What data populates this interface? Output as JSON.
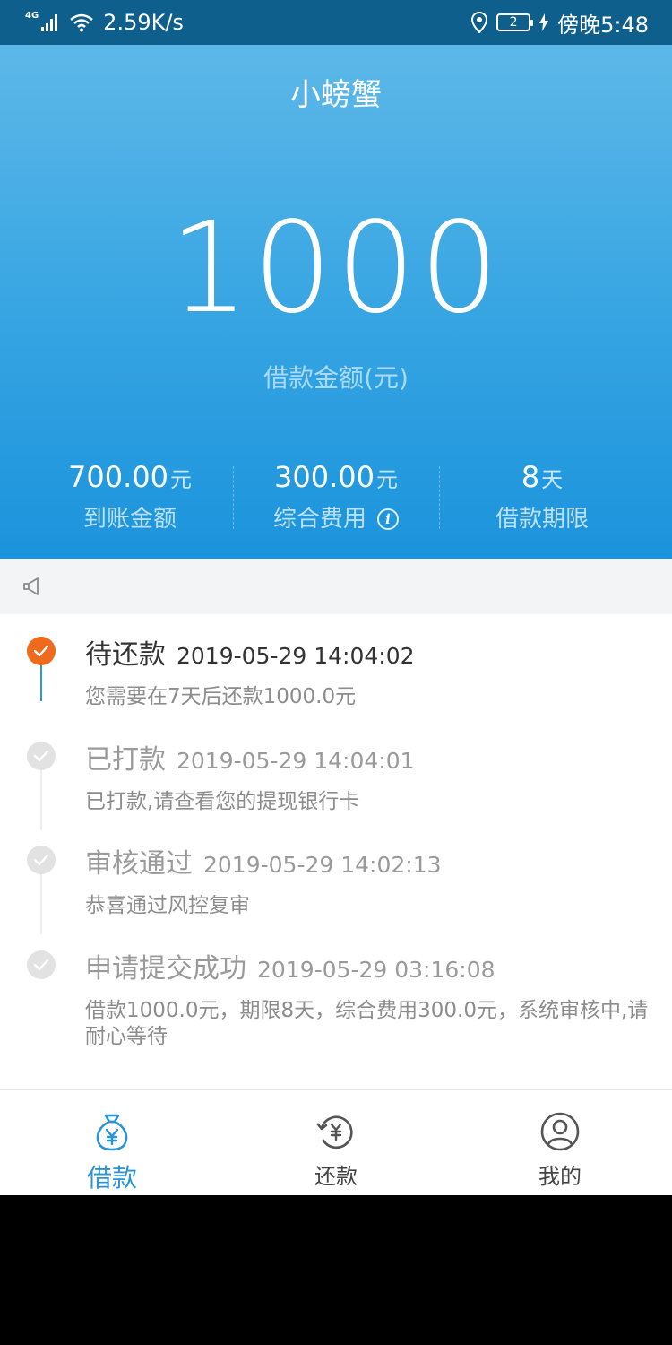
{
  "status_bar": {
    "network": "4G",
    "speed": "2.59K/s",
    "sim": "2",
    "time": "傍晚5:48"
  },
  "header": {
    "title": "小螃蟹"
  },
  "loan": {
    "amount": "1000",
    "amount_label": "借款金额(元)",
    "stats": [
      {
        "value": "700.00",
        "unit": "元",
        "label": "到账金额"
      },
      {
        "value": "300.00",
        "unit": "元",
        "label": "综合费用",
        "info_icon": "i"
      },
      {
        "value": "8",
        "unit": "天",
        "label": "借款期限"
      }
    ]
  },
  "notice": {
    "icon": "speaker-icon"
  },
  "timeline": [
    {
      "status": "待还款",
      "time": "2019-05-29 14:04:02",
      "desc": "您需要在7天后还款1000.0元",
      "active": true
    },
    {
      "status": "已打款",
      "time": "2019-05-29 14:04:01",
      "desc": "已打款,请查看您的提现银行卡",
      "active": false
    },
    {
      "status": "审核通过",
      "time": "2019-05-29 14:02:13",
      "desc": "恭喜通过风控复审",
      "active": false
    },
    {
      "status": "申请提交成功",
      "time": "2019-05-29 03:16:08",
      "desc": "借款1000.0元，期限8天，综合费用300.0元，系统审核中,请耐心等待",
      "active": false
    }
  ],
  "tabs": [
    {
      "label": "借款",
      "icon": "money-bag-icon",
      "active": true
    },
    {
      "label": "还款",
      "icon": "repay-icon",
      "active": false
    },
    {
      "label": "我的",
      "icon": "user-icon",
      "active": false
    }
  ],
  "colors": {
    "accent": "#2a93d5",
    "active_dot": "#f06a1d",
    "status_bar": "#0e5f8b"
  }
}
